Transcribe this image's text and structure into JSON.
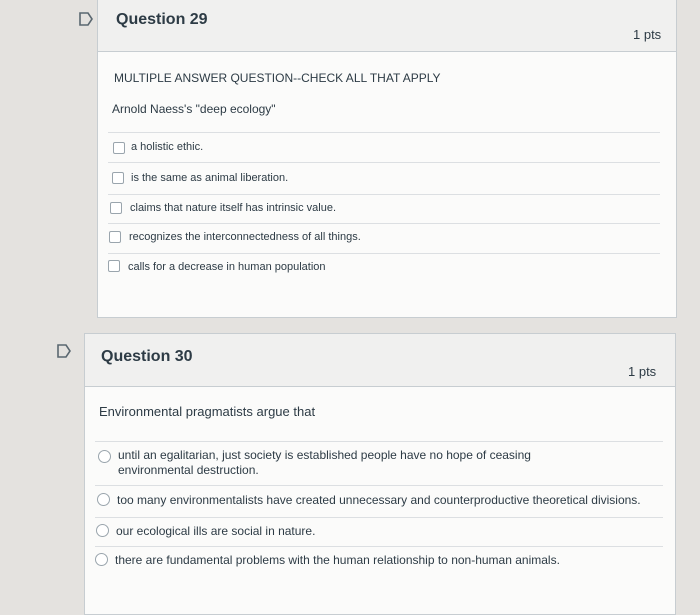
{
  "q29": {
    "title": "Question 29",
    "points": "1 pts",
    "instruction": "MULTIPLE ANSWER QUESTION--CHECK ALL THAT APPLY",
    "prompt": "Arnold Naess's \"deep ecology\"",
    "options": [
      "a holistic ethic.",
      "is the same as animal liberation.",
      "claims that nature itself has intrinsic value.",
      "recognizes the interconnectedness of all things.",
      "calls for a decrease in human population"
    ]
  },
  "q30": {
    "title": "Question 30",
    "points": "1 pts",
    "prompt": "Environmental pragmatists argue that",
    "options": [
      "until an egalitarian, just society is established people have no hope of ceasing environmental destruction.",
      "too many environmentalists have created unnecessary and counterproductive theoretical divisions.",
      "our ecological ills are social in nature.",
      "there are fundamental problems with the human relationship to non-human animals."
    ]
  },
  "colors": {
    "background": "#e4e2df",
    "card": "#fbfbfa",
    "header": "#f0f0ef",
    "flag": "#5a6770"
  },
  "icons": {
    "flag": "flag-icon"
  }
}
